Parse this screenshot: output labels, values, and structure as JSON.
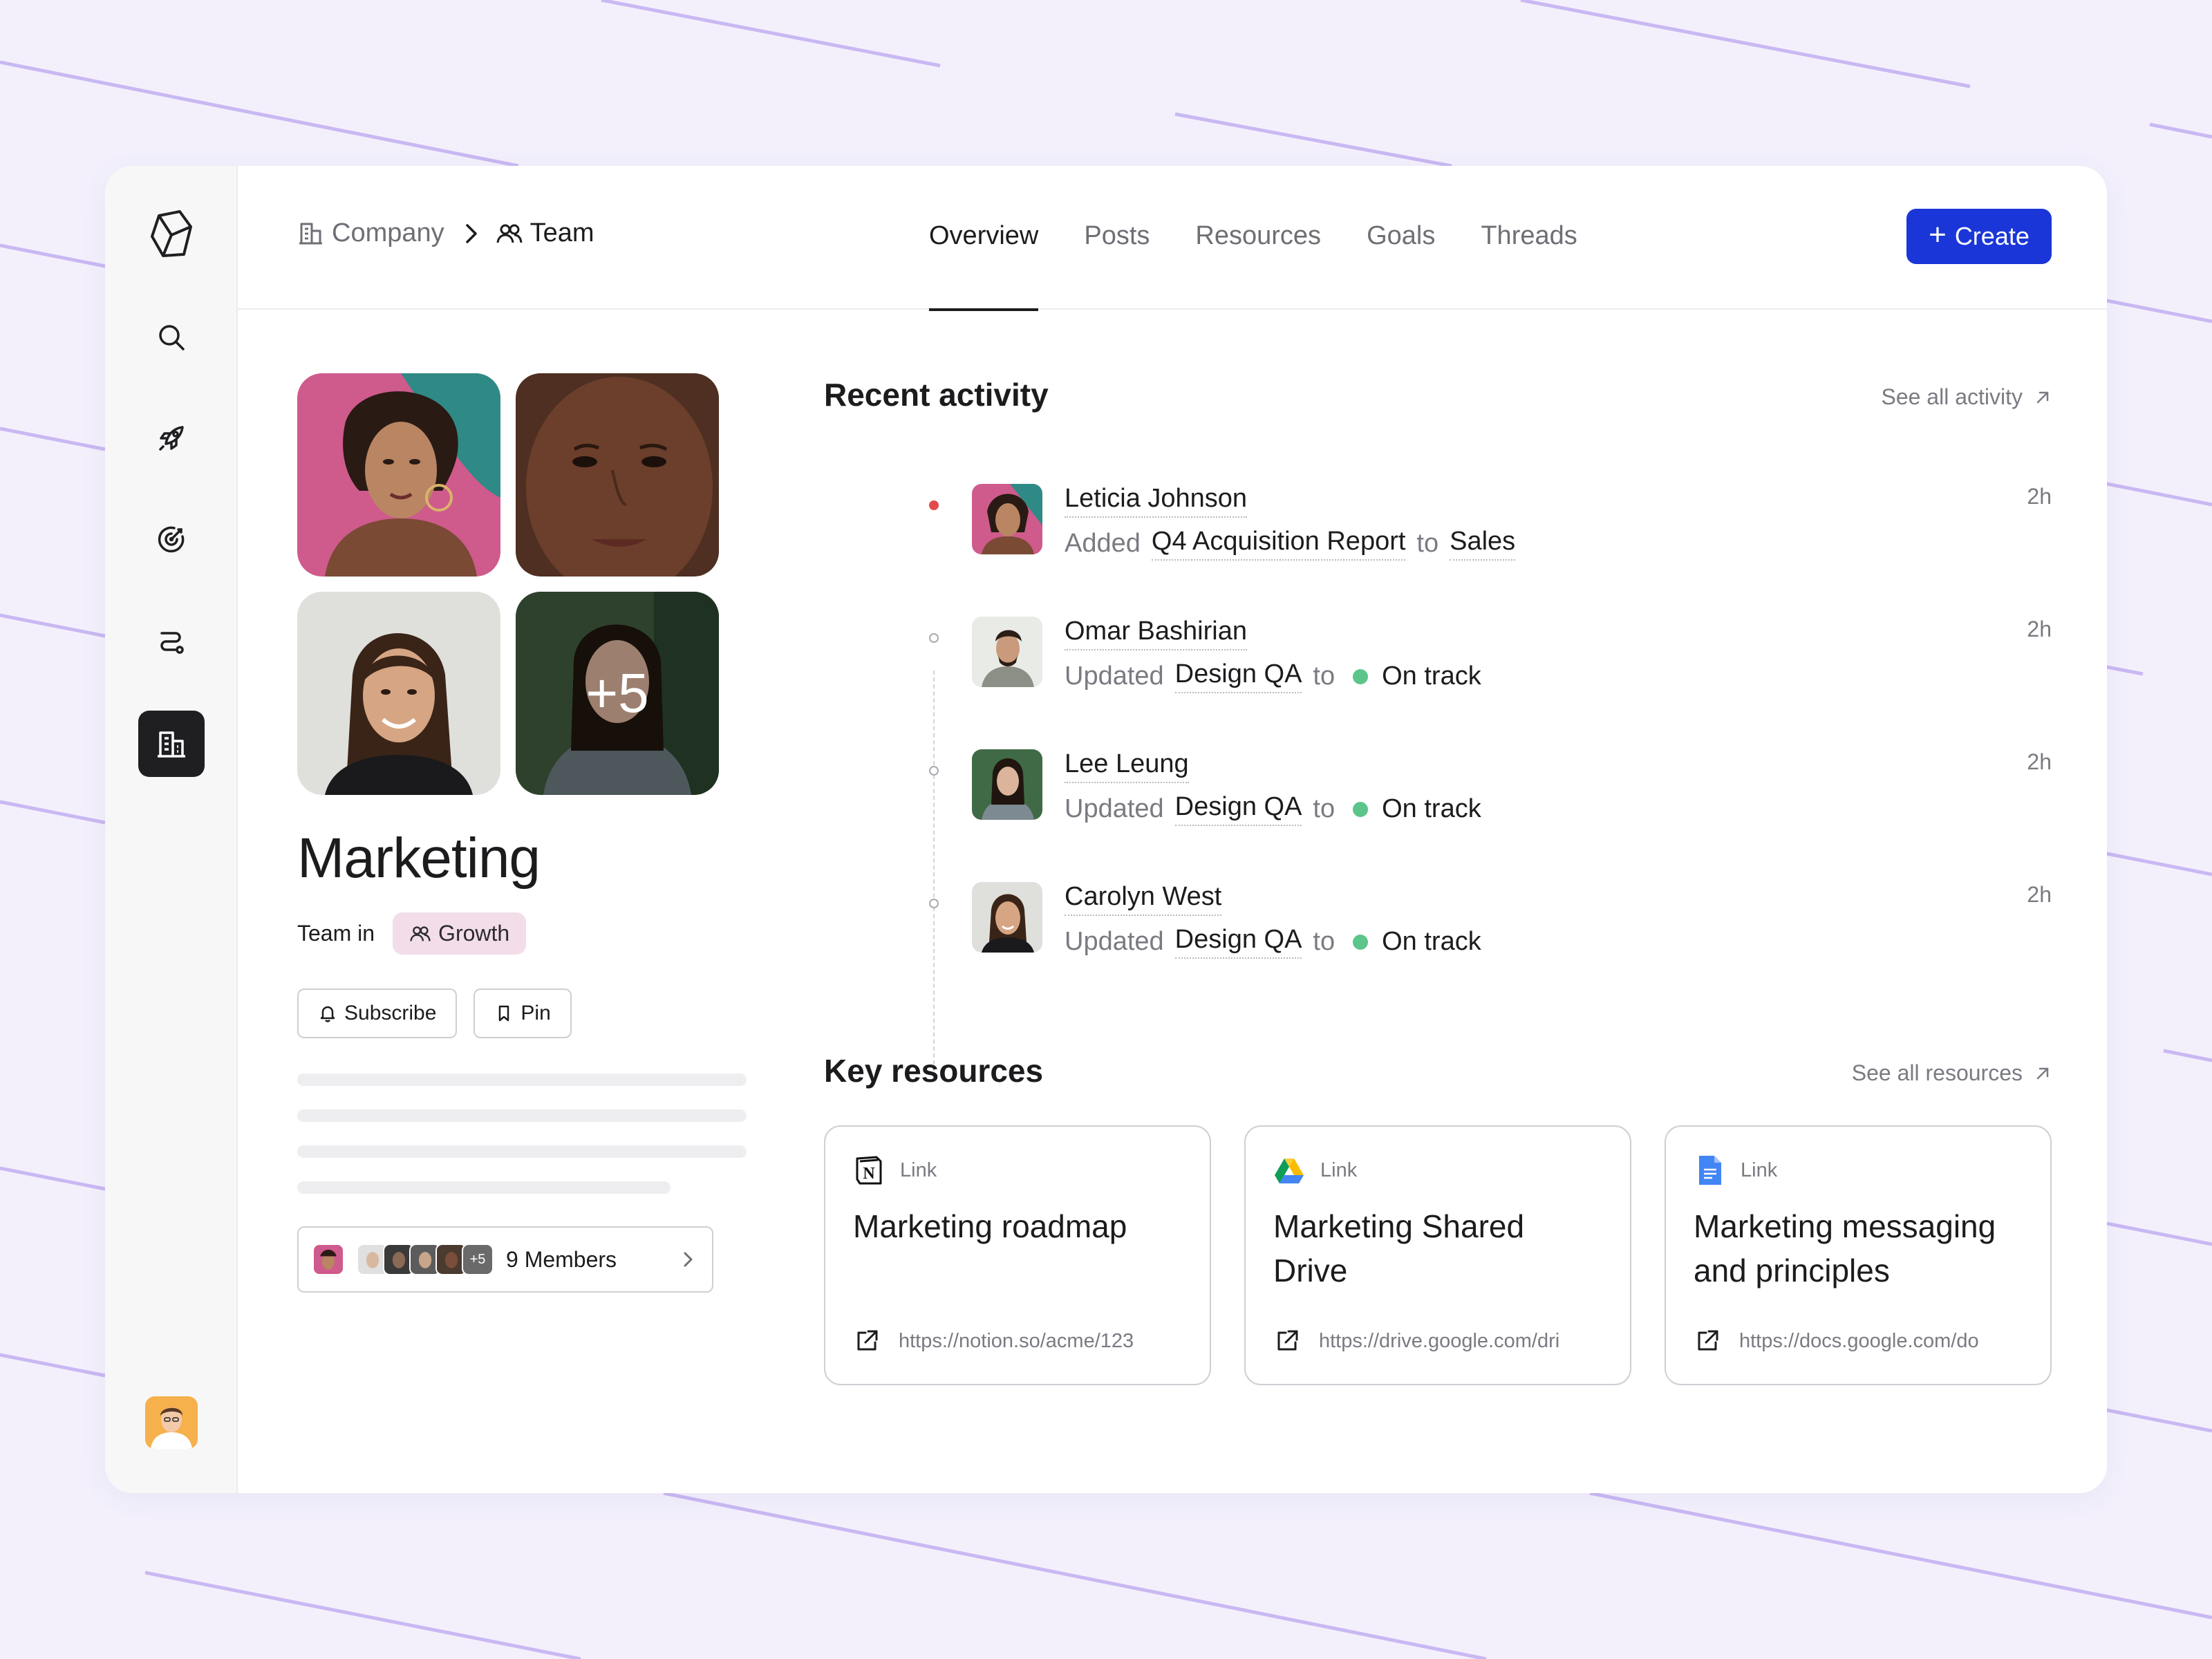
{
  "breadcrumb": {
    "company": "Company",
    "team": "Team"
  },
  "tabs": [
    "Overview",
    "Posts",
    "Resources",
    "Goals",
    "Threads"
  ],
  "active_tab": "Overview",
  "create_label": "Create",
  "team": {
    "more_count": "+5",
    "name": "Marketing",
    "team_in_label": "Team in",
    "parent": "Growth",
    "subscribe_label": "Subscribe",
    "pin_label": "Pin",
    "members_label": "9 Members",
    "members_more": "+5"
  },
  "recent_activity": {
    "title": "Recent activity",
    "see_all": "See all activity",
    "items": [
      {
        "name": "Leticia Johnson",
        "verb": "Added",
        "object": "Q4 Acquisition Report",
        "prep": "to",
        "target": "Sales",
        "time": "2h"
      },
      {
        "name": "Omar Bashirian",
        "verb": "Updated",
        "object": "Design QA",
        "prep": "to",
        "target": "On track",
        "time": "2h"
      },
      {
        "name": "Lee Leung",
        "verb": "Updated",
        "object": "Design QA",
        "prep": "to",
        "target": "On track",
        "time": "2h"
      },
      {
        "name": "Carolyn West",
        "verb": "Updated",
        "object": "Design QA",
        "prep": "to",
        "target": "On track",
        "time": "2h"
      }
    ]
  },
  "key_resources": {
    "title": "Key resources",
    "see_all": "See all resources",
    "cards": [
      {
        "type": "Link",
        "icon": "notion-icon",
        "title": "Marketing roadmap",
        "url": "https://notion.so/acme/123"
      },
      {
        "type": "Link",
        "icon": "google-drive-icon",
        "title": "Marketing Shared Drive",
        "url": "https://drive.google.com/dri"
      },
      {
        "type": "Link",
        "icon": "google-docs-icon",
        "title": "Marketing messaging and principles",
        "url": "https://docs.google.com/do"
      }
    ]
  },
  "colors": {
    "accent": "#1b36d8",
    "status_green": "#5bc58a",
    "timeline_active": "#e34b4b",
    "chip_bg": "#f2dde9",
    "background": "#f3f0fc"
  }
}
